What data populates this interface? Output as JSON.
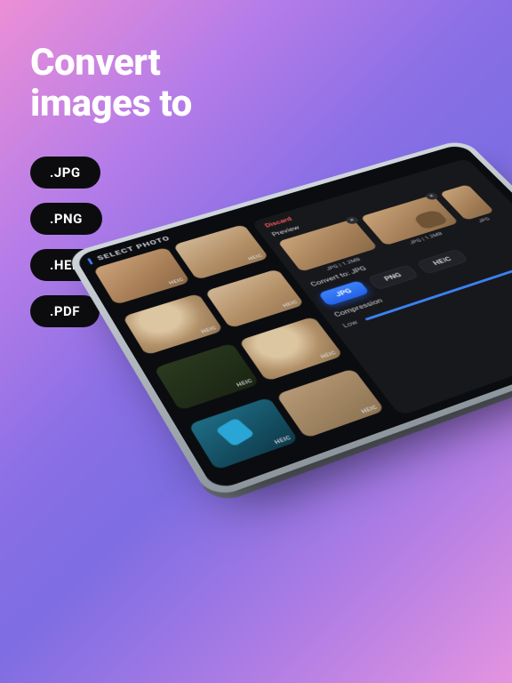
{
  "headline": {
    "line1": "Convert",
    "line2": "images to"
  },
  "format_chips": [
    ".JPG",
    ".PNG",
    ".HEIC",
    ".PDF"
  ],
  "app": {
    "title": "SELECT PHOTO",
    "grid_badge": "HEIC",
    "panel": {
      "discard": "Discard",
      "preview_label": "Preview",
      "previews": [
        {
          "meta": "JPG | 1.2MB"
        },
        {
          "meta": "JPG | 1.2MB"
        },
        {
          "meta": "JPG"
        }
      ],
      "convert_to_label": "Convert to:",
      "convert_to_value": "JPG",
      "formats": {
        "jpg": "JPG",
        "png": "PNG",
        "heic": "HEIC"
      },
      "compression_label": "Compression",
      "compression_low": "Low"
    }
  }
}
